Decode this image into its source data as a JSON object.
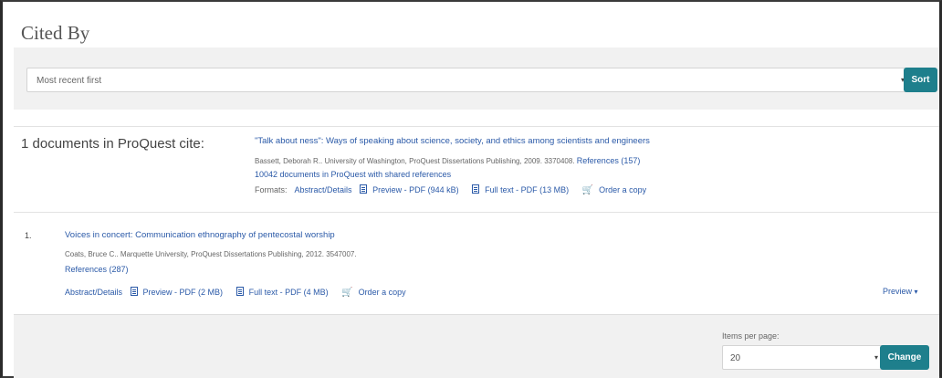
{
  "section_title": "Cited By",
  "sort": {
    "selected": "Most recent first",
    "button_label": "Sort"
  },
  "cite_summary": "1 documents in ProQuest cite:",
  "source_doc": {
    "title": "\"Talk about ness\": Ways of speaking about science, society, and ethics among scientists and engineers",
    "meta": "Bassett, Deborah R.. University of Washington, ProQuest Dissertations Publishing, 2009. 3370408.",
    "references": "References (157)",
    "shared_refs": "10042 documents in ProQuest with shared references",
    "formats_label": "Formats:",
    "abstract": "Abstract/Details",
    "preview_pdf": "Preview - PDF (944 kB)",
    "full_text_pdf": "Full text - PDF (13 MB)",
    "order": "Order a copy"
  },
  "results": [
    {
      "number": "1.",
      "title": "Voices in concert: Communication ethnography of pentecostal worship",
      "meta": "Coats, Bruce C.. Marquette University, ProQuest Dissertations Publishing, 2012. 3547007.",
      "references": "References (287)",
      "abstract": "Abstract/Details",
      "preview_pdf": "Preview - PDF (2 MB)",
      "full_text_pdf": "Full text - PDF (4 MB)",
      "order": "Order a copy",
      "preview_toggle": "Preview",
      "preview_caret": "▾"
    }
  ],
  "footer": {
    "items_per_page_label": "Items per page:",
    "items_per_page_value": "20",
    "change_button": "Change"
  },
  "icons": {
    "dropdown_caret": "▾",
    "cart": "🛒"
  },
  "colors": {
    "accent_button": "#1e7f8c",
    "link": "#2b5aa8"
  }
}
